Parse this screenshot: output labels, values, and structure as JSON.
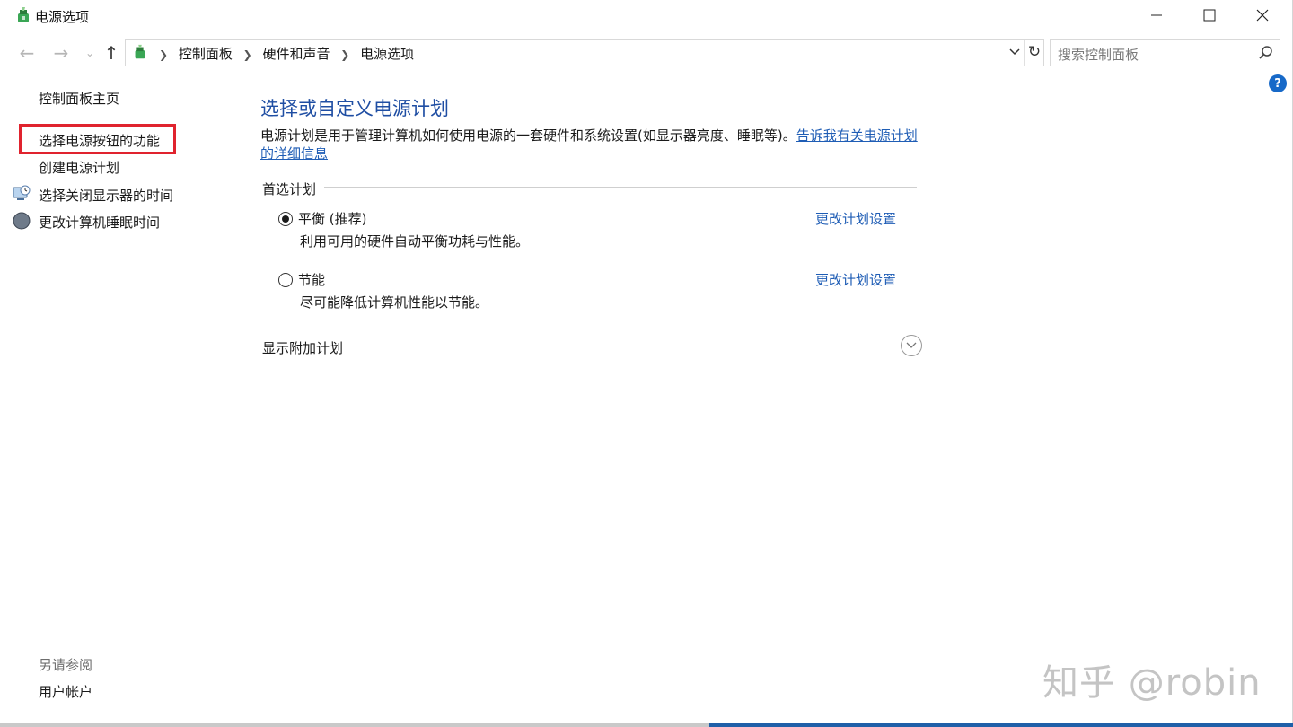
{
  "window": {
    "title": "电源选项",
    "controls": {
      "minimize": "minimize",
      "maximize": "maximize",
      "close": "close"
    }
  },
  "nav": {
    "breadcrumbs": [
      "控制面板",
      "硬件和声音",
      "电源选项"
    ],
    "search_placeholder": "搜索控制面板"
  },
  "sidebar": {
    "home": "控制面板主页",
    "links": [
      "选择电源按钮的功能",
      "创建电源计划",
      "选择关闭显示器的时间",
      "更改计算机睡眠时间"
    ],
    "see_also_label": "另请参阅",
    "see_also_links": [
      "用户帐户"
    ]
  },
  "main": {
    "title": "选择或自定义电源计划",
    "description": "电源计划是用于管理计算机如何使用电源的一套硬件和系统设置(如显示器亮度、睡眠等)。",
    "description_link": "告诉我有关电源计划的详细信息",
    "preferred_label": "首选计划",
    "plans": [
      {
        "name": "平衡 (推荐)",
        "description": "利用可用的硬件自动平衡功耗与性能。",
        "link": "更改计划设置",
        "selected": true
      },
      {
        "name": "节能",
        "description": "尽可能降低计算机性能以节能。",
        "link": "更改计划设置",
        "selected": false
      }
    ],
    "more_plans_label": "显示附加计划"
  },
  "help_label": "?",
  "watermark": "知乎 @robin",
  "colors": {
    "title_blue": "#1f4ea3",
    "link_blue": "#1f5db5",
    "highlight_red": "#e0232e",
    "help_blue": "#1769c8"
  },
  "icons": [
    "power-options-icon",
    "back-arrow-icon",
    "forward-arrow-icon",
    "up-arrow-icon",
    "refresh-icon",
    "search-icon",
    "help-icon",
    "display-icon",
    "sleep-icon",
    "chevron-down-icon"
  ]
}
